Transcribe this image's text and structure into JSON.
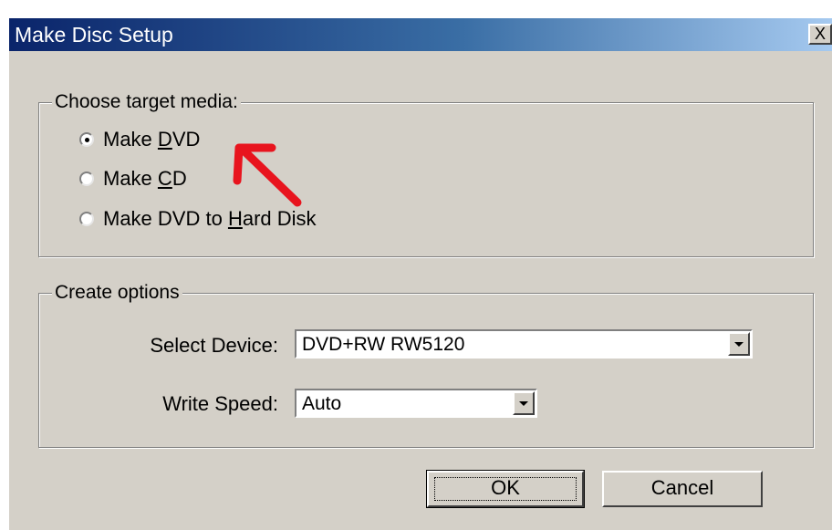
{
  "window": {
    "title": "Make Disc Setup",
    "close_glyph": "X"
  },
  "target_media": {
    "legend": "Choose target media:",
    "options": [
      {
        "pre": "Make ",
        "accel": "D",
        "post": "VD",
        "checked": true
      },
      {
        "pre": "Make ",
        "accel": "C",
        "post": "D",
        "checked": false
      },
      {
        "pre": "Make DVD to ",
        "accel": "H",
        "post": "ard Disk",
        "checked": false
      }
    ]
  },
  "create_options": {
    "legend": "Create options",
    "device_label": "Select Device:",
    "device_value": "DVD+RW RW5120",
    "speed_label": "Write Speed:",
    "speed_value": "Auto"
  },
  "buttons": {
    "ok": "OK",
    "cancel": "Cancel"
  },
  "annotation": {
    "arrow_color": "#e8141e"
  },
  "colors": {
    "dialog_bg": "#d4d0c8",
    "title_start": "#0a246a",
    "title_end": "#a6caf0"
  }
}
